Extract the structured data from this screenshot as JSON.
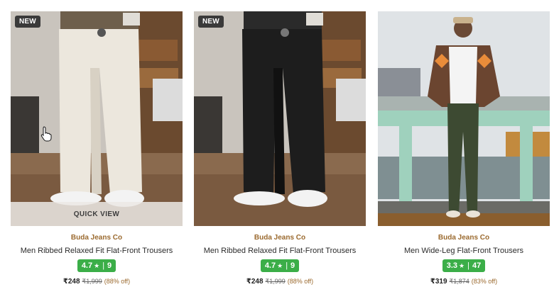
{
  "products": [
    {
      "badge": "NEW",
      "quick_view": "QUICK VIEW",
      "brand": "Buda Jeans Co",
      "title": "Men Ribbed Relaxed Fit Flat-Front Trousers",
      "rating": "4.7",
      "reviews": "9",
      "price": "₹248",
      "mrp": "₹1,999",
      "discount": "(88% off)"
    },
    {
      "badge": "NEW",
      "brand": "Buda Jeans Co",
      "title": "Men Ribbed Relaxed Fit Flat-Front Trousers",
      "rating": "4.7",
      "reviews": "9",
      "price": "₹248",
      "mrp": "₹1,999",
      "discount": "(88% off)"
    },
    {
      "brand": "Buda Jeans Co",
      "title": "Men Wide-Leg Flat-Front Trousers",
      "rating": "3.3",
      "reviews": "47",
      "price": "₹319",
      "mrp": "₹1,874",
      "discount": "(83% off)"
    }
  ],
  "icons": {
    "star": "★",
    "cursor": "hand-pointer-icon"
  },
  "colors": {
    "rating_bg": "#3bae48",
    "brand": "#9b6a2f",
    "badge_bg": "#3a3a3a"
  }
}
